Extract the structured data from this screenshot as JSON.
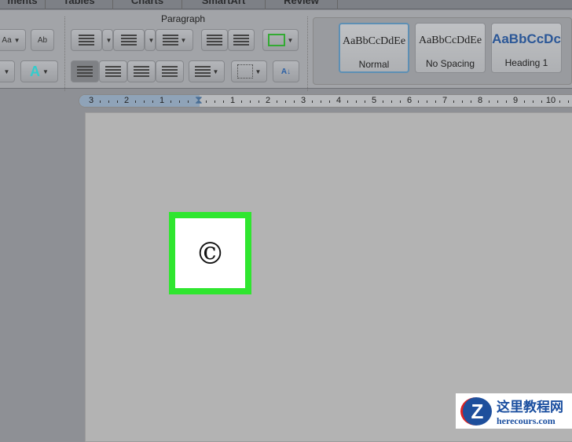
{
  "tabs": [
    "ments",
    "Tables",
    "Charts",
    "SmartArt",
    "Review"
  ],
  "ribbon": {
    "group_label": "Paragraph"
  },
  "styles": [
    {
      "sample": "AaBbCcDdEe",
      "name": "Normal"
    },
    {
      "sample": "AaBbCcDdEe",
      "name": "No Spacing"
    },
    {
      "sample": "AaBbCcDc",
      "name": "Heading 1"
    }
  ],
  "ruler": {
    "numbers": [
      "3",
      "2",
      "1",
      "",
      "1",
      "2",
      "3",
      "4",
      "5",
      "6",
      "7",
      "8",
      "9",
      "10"
    ]
  },
  "document": {
    "symbol": "©"
  },
  "watermark": {
    "title": "这里教程网",
    "url": "herecours.com",
    "logo": "Z"
  },
  "colors": {
    "highlight": "#2fe62f",
    "heading": "#2b5797"
  }
}
